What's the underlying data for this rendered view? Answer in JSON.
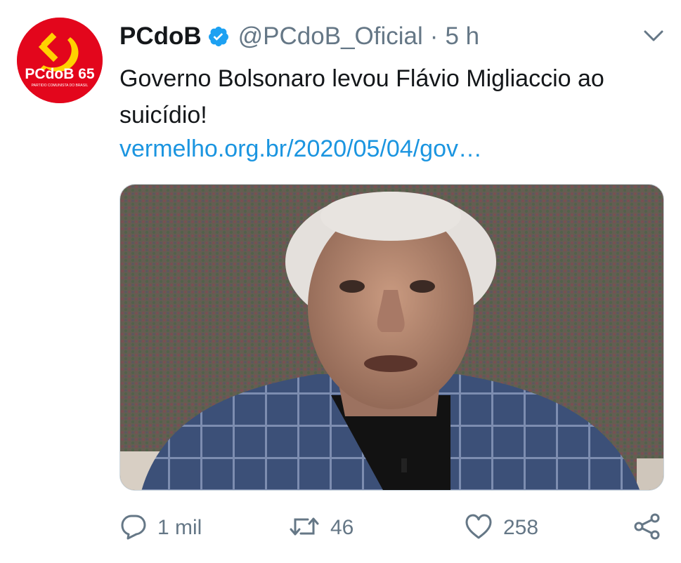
{
  "tweet": {
    "author_name": "PCdoB",
    "handle": "@PCdoB_Oficial",
    "separator": "·",
    "time": "5 h",
    "text": "Governo Bolsonaro levou Flávio Migliaccio ao suicídio!",
    "link_text": "vermelho.org.br/2020/05/04/gov…"
  },
  "avatar": {
    "logo_text": "PCdoB 65",
    "logo_subtext": "PARTIDO COMUNISTA DO BRASIL",
    "color": "#e3061c"
  },
  "actions": {
    "reply_count": "1 mil",
    "retweet_count": "46",
    "like_count": "258"
  },
  "icons": [
    "verified-badge-icon",
    "chevron-down-icon",
    "reply-icon",
    "retweet-icon",
    "like-icon",
    "share-icon"
  ],
  "colors": {
    "link": "#1b95e0",
    "secondary_text": "#657786",
    "verified": "#1da1f2",
    "primary_text": "#14171a"
  }
}
